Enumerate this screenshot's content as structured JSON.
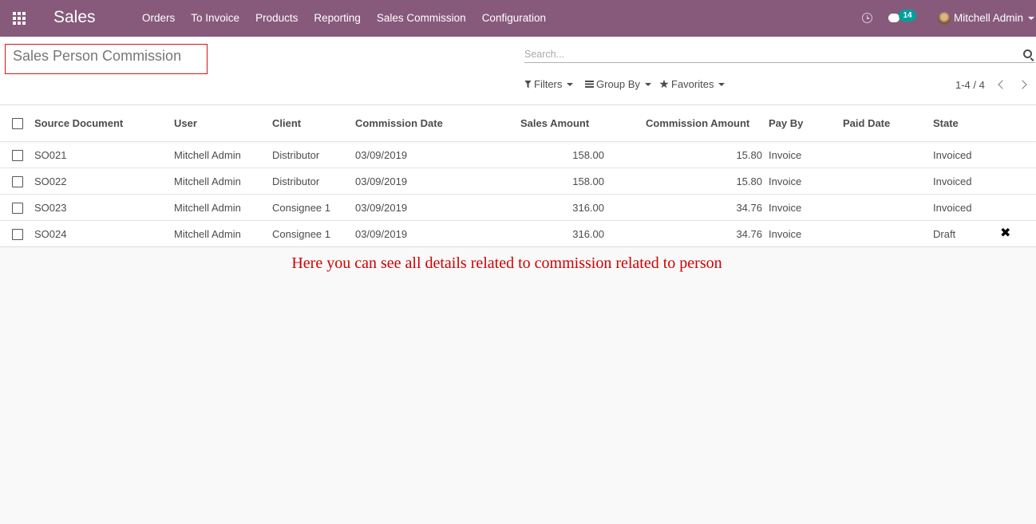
{
  "navbar": {
    "brand": "Sales",
    "menu": [
      "Orders",
      "To Invoice",
      "Products",
      "Reporting",
      "Sales Commission",
      "Configuration"
    ],
    "chat_count": "14",
    "user_name": "Mitchell Admin",
    "color": "#875a7b"
  },
  "control_panel": {
    "title": "Sales Person Commission",
    "search_placeholder": "Search...",
    "filters_label": "Filters",
    "group_by_label": "Group By",
    "favorites_label": "Favorites",
    "pager": "1-4 / 4"
  },
  "table": {
    "headers": [
      "Source Document",
      "User",
      "Client",
      "Commission Date",
      "Sales Amount",
      "Commission Amount",
      "Pay By",
      "Paid Date",
      "State"
    ],
    "rows": [
      {
        "source": "SO021",
        "user": "Mitchell Admin",
        "client": "Distributor",
        "date": "03/09/2019",
        "sales_amount": "158.00",
        "commission_amount": "15.80",
        "pay_by": "Invoice",
        "paid_date": "",
        "state": "Invoiced"
      },
      {
        "source": "SO022",
        "user": "Mitchell Admin",
        "client": "Distributor",
        "date": "03/09/2019",
        "sales_amount": "158.00",
        "commission_amount": "15.80",
        "pay_by": "Invoice",
        "paid_date": "",
        "state": "Invoiced"
      },
      {
        "source": "SO023",
        "user": "Mitchell Admin",
        "client": "Consignee 1",
        "date": "03/09/2019",
        "sales_amount": "316.00",
        "commission_amount": "34.76",
        "pay_by": "Invoice",
        "paid_date": "",
        "state": "Invoiced"
      },
      {
        "source": "SO024",
        "user": "Mitchell Admin",
        "client": "Consignee 1",
        "date": "03/09/2019",
        "sales_amount": "316.00",
        "commission_amount": "34.76",
        "pay_by": "Invoice",
        "paid_date": "",
        "state": "Draft"
      }
    ]
  },
  "annotation": "Here you can see all details related to commission related to person"
}
